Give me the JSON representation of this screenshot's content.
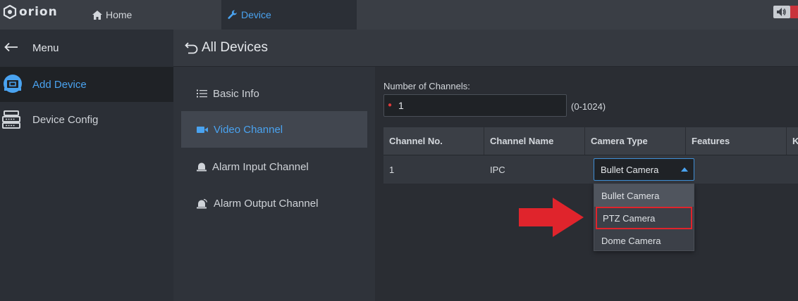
{
  "app": {
    "logo_text": "orion"
  },
  "tabs": [
    {
      "label": "Home",
      "icon": "home-icon"
    },
    {
      "label": "Device",
      "icon": "wrench-icon",
      "active": true
    }
  ],
  "menu": {
    "title": "Menu",
    "items": [
      {
        "label": "Add Device",
        "icon": "add-device-icon",
        "active": true
      },
      {
        "label": "Device Config",
        "icon": "device-config-icon"
      }
    ]
  },
  "content": {
    "title": "All Devices"
  },
  "subnav": {
    "items": [
      {
        "label": "Basic Info",
        "icon": "list-icon"
      },
      {
        "label": "Video Channel",
        "icon": "video-camera-icon",
        "active": true
      },
      {
        "label": "Alarm Input Channel",
        "icon": "alarm-bell-icon"
      },
      {
        "label": "Alarm Output Channel",
        "icon": "alarm-output-icon"
      }
    ]
  },
  "channels": {
    "label": "Number of Channels:",
    "value": "1",
    "range": "(0-1024)"
  },
  "table": {
    "headers": [
      "Channel No.",
      "Channel Name",
      "Camera Type",
      "Features",
      "K"
    ],
    "rows": [
      {
        "channel_no": "1",
        "channel_name": "IPC",
        "camera_type": "Bullet Camera"
      }
    ]
  },
  "camera_type_dropdown": {
    "selected": "Bullet Camera",
    "options": [
      "Bullet Camera",
      "PTZ Camera",
      "Dome Camera"
    ]
  },
  "colors": {
    "accent": "#4aa3f0",
    "highlight_red": "#e0242c"
  }
}
